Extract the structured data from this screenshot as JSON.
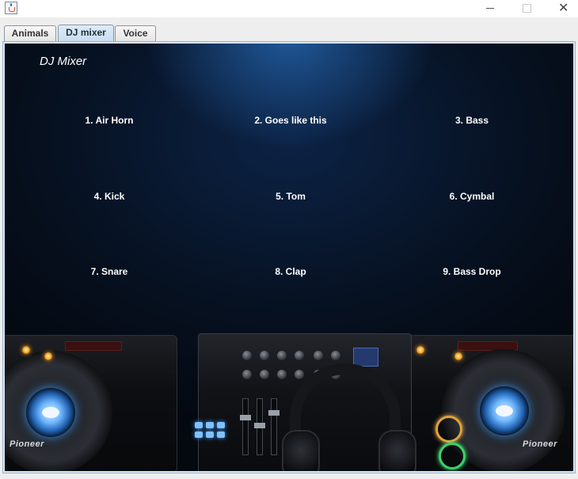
{
  "tabs": [
    {
      "label": "Animals",
      "active": false
    },
    {
      "label": "DJ mixer",
      "active": true
    },
    {
      "label": "Voice",
      "active": false
    }
  ],
  "panel": {
    "title": "DJ Mixer",
    "buttons": [
      "1. Air Horn",
      "2. Goes like this",
      "3. Bass",
      "4. Kick",
      "5. Tom",
      "6. Cymbal",
      "7. Snare",
      "8. Clap",
      "9. Bass Drop"
    ]
  },
  "brand": "Pioneer",
  "colors": {
    "background": "#06101f",
    "accent_blue": "#3d8fe8",
    "led_orange": "#ffb12e",
    "text": "#ffffff"
  },
  "icons": {
    "app": "java-cup-icon",
    "minimize": "minimize-icon",
    "maximize": "maximize-icon",
    "close": "close-icon"
  }
}
